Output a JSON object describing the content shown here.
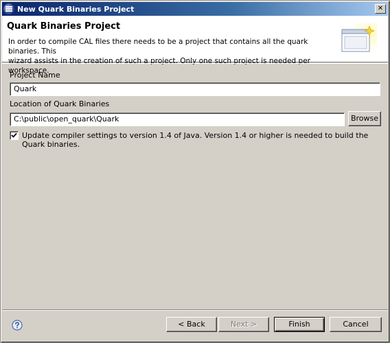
{
  "window": {
    "title": "New Quark Binaries Project",
    "close_glyph": "✕"
  },
  "header": {
    "title": "Quark Binaries Project",
    "description_line1": "In order to compile CAL files there needs to be a project that contains all the quark binaries. This",
    "description_line2": "wizard assists in the creation of such a project. Only one such project is needed per workspace.",
    "graphic_icon": "new-wizard-icon"
  },
  "form": {
    "project_name_label": "Project Name",
    "project_name_value": "Quark",
    "location_label": "Location of Quark Binaries",
    "location_value": "C:\\public\\open_quark\\Quark",
    "browse_label": "Browse",
    "update_compiler_checked": true,
    "update_compiler_label": "Update compiler settings to version 1.4 of Java. Version 1.4 or higher is needed to build the Quark binaries."
  },
  "footer": {
    "help_icon": "help-icon",
    "back_label": "< Back",
    "next_label": "Next >",
    "finish_label": "Finish",
    "cancel_label": "Cancel"
  }
}
